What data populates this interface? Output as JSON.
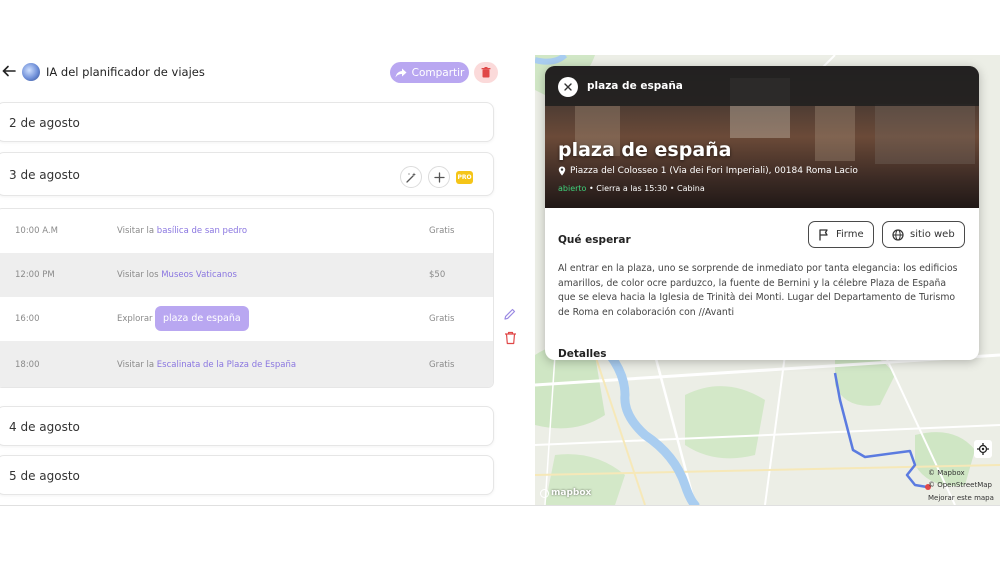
{
  "header": {
    "title": "IA del planificador de viajes",
    "share_label": "Compartir"
  },
  "days": [
    {
      "label": "2 de agosto"
    },
    {
      "label": "3 de agosto"
    },
    {
      "label": "4 de agosto"
    },
    {
      "label": "5 de agosto"
    }
  ],
  "pro_label": "PRO",
  "schedule": [
    {
      "time": "10:00 A.M",
      "verb": "Visitar la",
      "place": "basílica de san pedro",
      "price": "Gratis"
    },
    {
      "time": "12:00 PM",
      "verb": "Visitar los",
      "place": "Museos Vaticanos",
      "price": "$50"
    },
    {
      "time": "16:00",
      "verb": "Explorar",
      "place": "plaza de españa",
      "price": "Gratis"
    },
    {
      "time": "18:00",
      "verb": "Visitar la",
      "place": "Escalinata de la Plaza de España",
      "price": "Gratis"
    }
  ],
  "popup": {
    "small_title": "plaza de españa",
    "big_title": "plaza de españa",
    "address": "Piazza del Colosseo 1 (Via dei Fori Imperiali), 00184 Roma Lacio",
    "status_open": "abierto",
    "status_rest": " • Cierra a las 15:30 • Cabina",
    "section_title": "Qué esperar",
    "sign_label": "Firme",
    "website_label": "sitio web",
    "description": "Al entrar en la plaza, uno se sorprende de inmediato por tanta elegancia: los edificios amarillos, de color ocre parduzco, la fuente de Bernini y la célebre Plaza de España que se eleva hacia la Iglesia de Trinità dei Monti. Lugar del Departamento de Turismo de Roma en colaboración con //Avanti",
    "details_title": "Detalles"
  },
  "map": {
    "attribution_mapbox": "© Mapbox",
    "attribution_osm": "© OpenStreetMap",
    "improve_label": "Mejorar este mapa",
    "logo_label": "mapbox"
  },
  "colors": {
    "accent": "#b9a7f1",
    "link": "#8a76e0",
    "danger": "#e04848",
    "open": "#3fd17a",
    "route": "#5b7be0"
  },
  "icons": {
    "back": "arrow-left-icon",
    "share": "share-arrow-icon",
    "trash": "trash-icon",
    "wand": "magic-wand-icon",
    "add": "plus-icon",
    "edit": "pencil-icon",
    "close": "close-icon",
    "pin": "map-pin-icon",
    "flag": "flag-icon",
    "globe": "globe-icon",
    "locate": "locate-icon"
  }
}
